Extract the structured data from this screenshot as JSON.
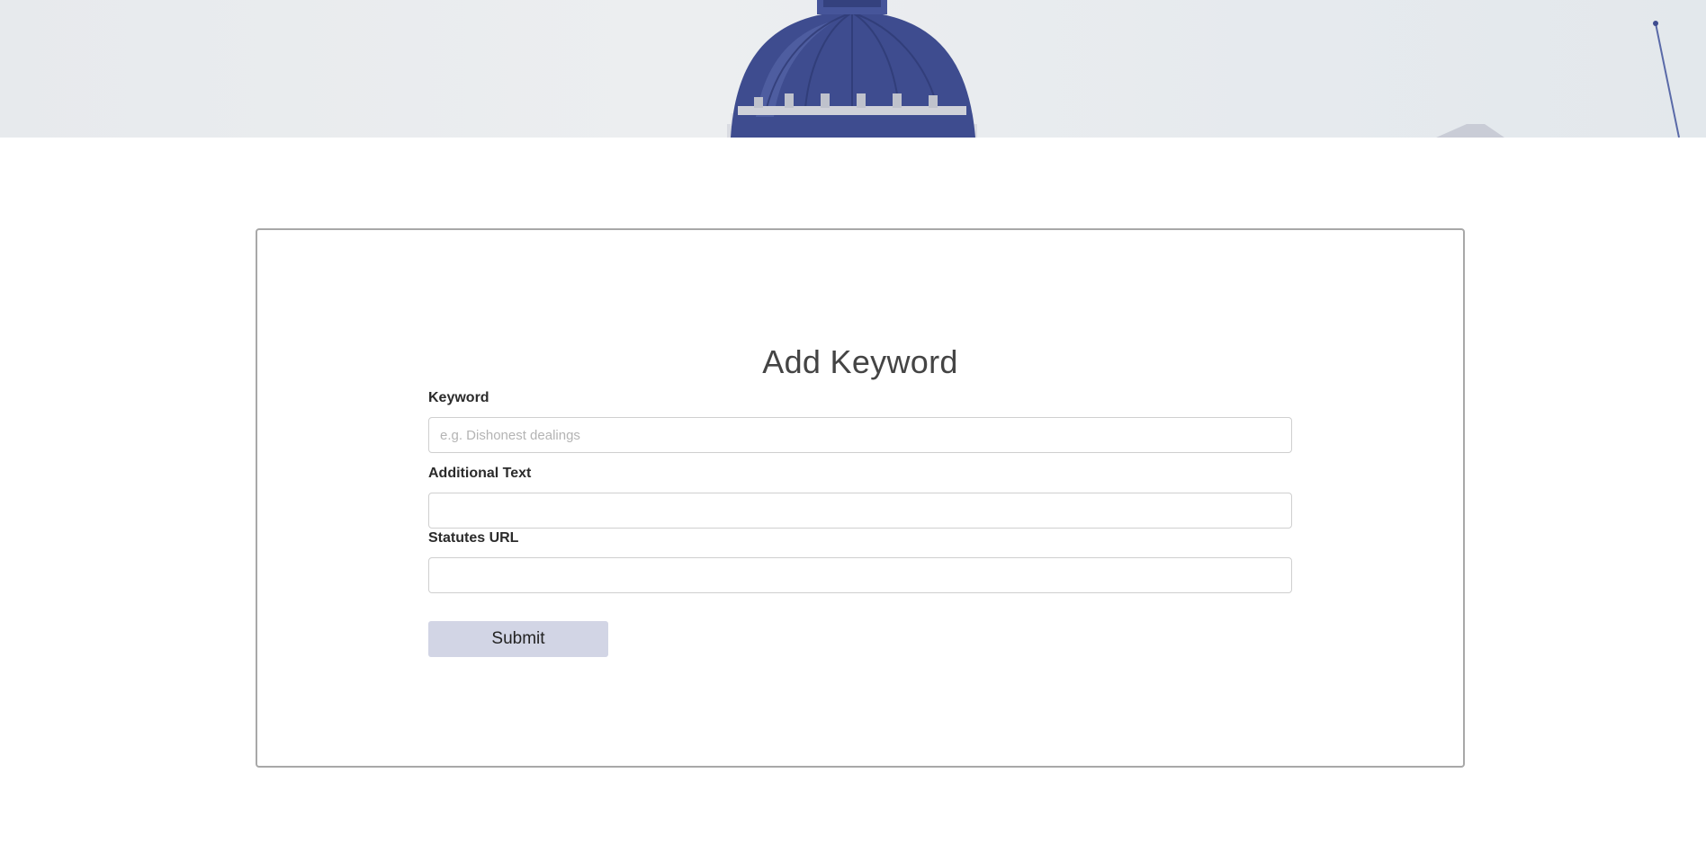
{
  "hero": {
    "image": "capitol-dome-banner",
    "dome_color": "#3e4c8f"
  },
  "form": {
    "title": "Add Keyword",
    "keyword": {
      "label": "Keyword",
      "placeholder": "e.g. Dishonest dealings",
      "value": ""
    },
    "additional_text": {
      "label": "Additional Text",
      "placeholder": "",
      "value": ""
    },
    "statutes_url": {
      "label": "Statutes URL",
      "placeholder": "",
      "value": ""
    },
    "submit_label": "Submit"
  },
  "colors": {
    "submit_bg": "#d2d5e5",
    "card_border": "#a8a8a8",
    "title_text": "#444444"
  }
}
